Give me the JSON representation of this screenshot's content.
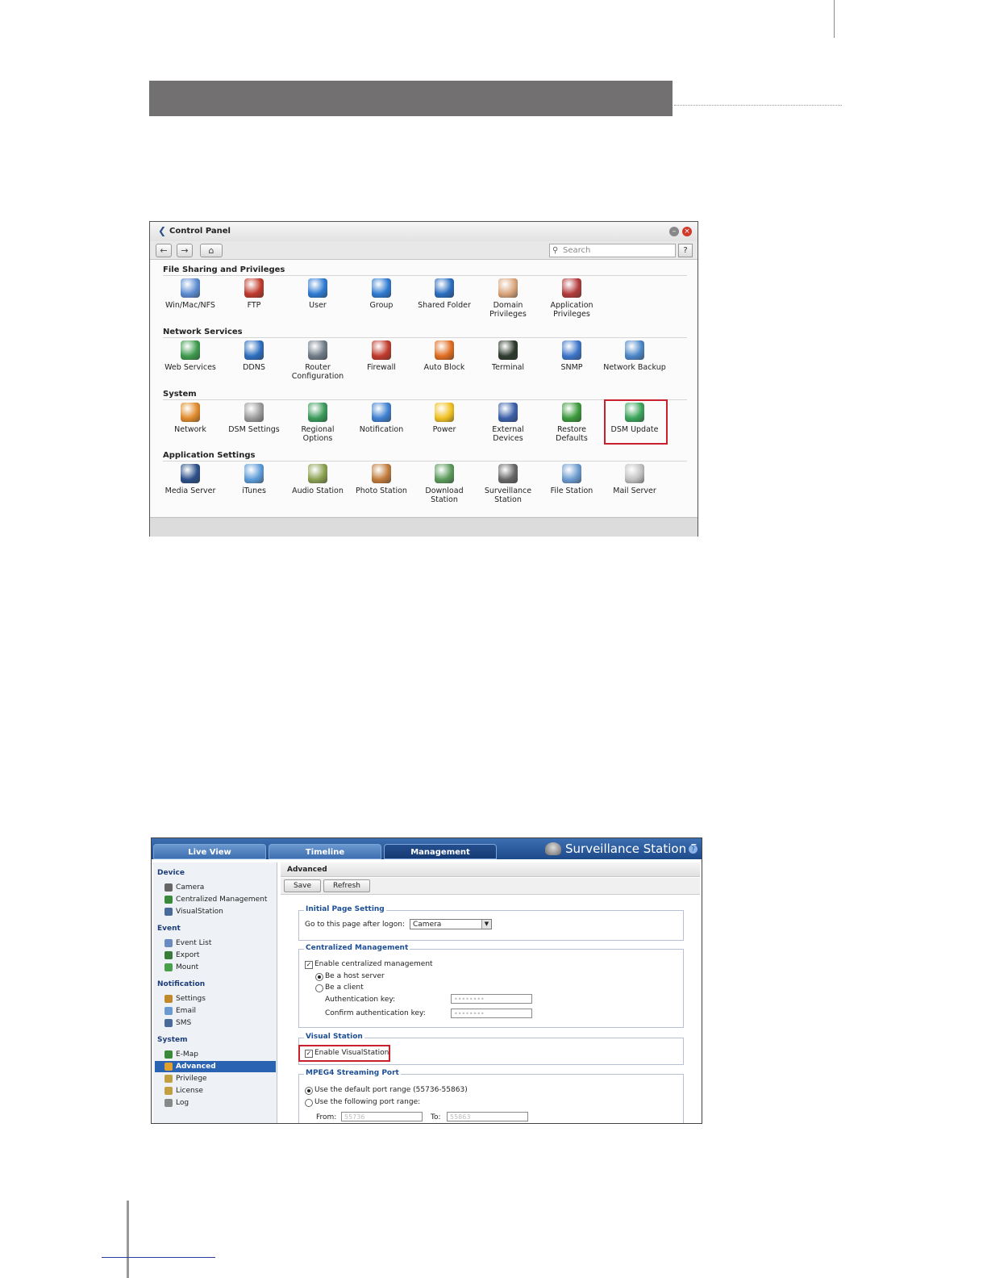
{
  "control_panel": {
    "title": "Control Panel",
    "search_placeholder": "Search",
    "help": "?",
    "sections": [
      {
        "title": "File Sharing and Privileges",
        "items": [
          {
            "label": "Win/Mac/NFS",
            "icon": "monitor-icon",
            "color": "#5b8bd0"
          },
          {
            "label": "FTP",
            "icon": "ftp-icon",
            "color": "#c0392b"
          },
          {
            "label": "User",
            "icon": "user-icon",
            "color": "#2e7ad1"
          },
          {
            "label": "Group",
            "icon": "group-icon",
            "color": "#2e7ad1"
          },
          {
            "label": "Shared Folder",
            "icon": "shared-folder-icon",
            "color": "#2a6cc0"
          },
          {
            "label": "Domain Privileges",
            "icon": "domain-privileges-icon",
            "color": "#d9a47a"
          },
          {
            "label": "Application Privileges",
            "icon": "application-privileges-icon",
            "color": "#b23a3a"
          }
        ]
      },
      {
        "title": "Network Services",
        "items": [
          {
            "label": "Web Services",
            "icon": "globe-icon",
            "color": "#3c9a4c"
          },
          {
            "label": "DDNS",
            "icon": "ddns-icon",
            "color": "#2b6dbf"
          },
          {
            "label": "Router Configuration",
            "icon": "router-icon",
            "color": "#6e7a86"
          },
          {
            "label": "Firewall",
            "icon": "firewall-icon",
            "color": "#c0392b"
          },
          {
            "label": "Auto Block",
            "icon": "auto-block-icon",
            "color": "#e06b1f"
          },
          {
            "label": "Terminal",
            "icon": "terminal-icon",
            "color": "#2d3a2d"
          },
          {
            "label": "SNMP",
            "icon": "snmp-icon",
            "color": "#3a74c8"
          },
          {
            "label": "Network Backup",
            "icon": "network-backup-icon",
            "color": "#4a86c8"
          }
        ]
      },
      {
        "title": "System",
        "items": [
          {
            "label": "Network",
            "icon": "home-network-icon",
            "color": "#e08a2a"
          },
          {
            "label": "DSM Settings",
            "icon": "gear-icon",
            "color": "#9a9a9a"
          },
          {
            "label": "Regional Options",
            "icon": "regional-options-icon",
            "color": "#3a9a5a"
          },
          {
            "label": "Notification",
            "icon": "notification-icon",
            "color": "#3d7fd0"
          },
          {
            "label": "Power",
            "icon": "power-bulb-icon",
            "color": "#f0c020"
          },
          {
            "label": "External Devices",
            "icon": "external-devices-icon",
            "color": "#3b5fa8"
          },
          {
            "label": "Restore Defaults",
            "icon": "restore-defaults-icon",
            "color": "#3a9a3a"
          },
          {
            "label": "DSM Update",
            "icon": "dsm-update-icon",
            "color": "#3aa45a"
          }
        ]
      },
      {
        "title": "Application Settings",
        "items": [
          {
            "label": "Media Server",
            "icon": "media-server-icon",
            "color": "#2b4f8a"
          },
          {
            "label": "iTunes",
            "icon": "itunes-icon",
            "color": "#5a9ad8"
          },
          {
            "label": "Audio Station",
            "icon": "audio-station-icon",
            "color": "#8aa050"
          },
          {
            "label": "Photo Station",
            "icon": "photo-station-icon",
            "color": "#c07a3a"
          },
          {
            "label": "Download Station",
            "icon": "download-station-icon",
            "color": "#5a9a5a"
          },
          {
            "label": "Surveillance Station",
            "icon": "surveillance-station-icon",
            "color": "#666666"
          },
          {
            "label": "File Station",
            "icon": "file-station-icon",
            "color": "#6a9ad0"
          },
          {
            "label": "Mail Server",
            "icon": "mail-server-icon",
            "color": "#c0c0c0"
          }
        ]
      }
    ]
  },
  "surveillance": {
    "brand": "Surveillance Station 5",
    "tabs": [
      "Live View",
      "Timeline",
      "Management"
    ],
    "sidebar": [
      {
        "title": "Device",
        "items": [
          "Camera",
          "Centralized Management",
          "VisualStation"
        ]
      },
      {
        "title": "Event",
        "items": [
          "Event List",
          "Export",
          "Mount"
        ]
      },
      {
        "title": "Notification",
        "items": [
          "Settings",
          "Email",
          "SMS"
        ]
      },
      {
        "title": "System",
        "items": [
          "E-Map",
          "Advanced",
          "Privilege",
          "License",
          "Log"
        ]
      }
    ],
    "main": {
      "heading": "Advanced",
      "save": "Save",
      "refresh": "Refresh",
      "initial_page": {
        "legend": "Initial Page Setting",
        "label": "Go to this page after logon:",
        "value": "Camera"
      },
      "centralized": {
        "legend": "Centralized Management",
        "enable": "Enable centralized management",
        "host": "Be a host server",
        "client": "Be a client",
        "auth_key": "Authentication key:",
        "confirm_key": "Confirm authentication key:",
        "auth_value": "••••••••",
        "confirm_value": "••••••••"
      },
      "visual_station": {
        "legend": "Visual Station",
        "enable": "Enable VisualStation"
      },
      "mpeg4": {
        "legend": "MPEG4 Streaming Port",
        "default_range": "Use the default port range (55736-55863)",
        "custom_range": "Use the following port range:",
        "from": "From:",
        "to": "To:",
        "from_value": "55736",
        "to_value": "55863"
      }
    }
  }
}
